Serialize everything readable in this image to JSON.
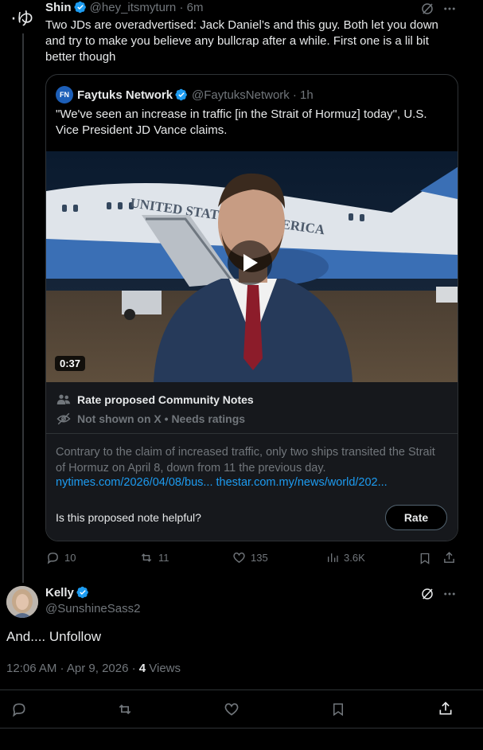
{
  "top_post": {
    "display_name": "Shin",
    "handle": "@hey_itsmyturn",
    "time": "· 6m",
    "text": "Two JDs are overadvertised: Jack Daniel’s and this guy. Both let you down and try to make you believe any bullcrap after a while. First one is a lil bit better though",
    "avatar_glyph": "·ゆ",
    "quoted": {
      "source_name": "Faytuks Network",
      "source_handle": "@FaytuksNetwork",
      "source_time": "· 1h",
      "logo_text": "FN",
      "text": "\"We've seen an increase in traffic [in the Strait of Hormuz] today\", U.S. Vice President JD Vance claims.",
      "video_duration": "0:37",
      "plane_text": "UNITED STATES OF AMERICA"
    },
    "community_notes": {
      "title": "Rate proposed Community Notes",
      "status": "Not shown on X • Needs ratings",
      "note_text": "Contrary to the claim of increased traffic, only two ships transited the Strait of Hormuz on April 8, down from 11 the previous day.",
      "link1": "nytimes.com/2026/04/08/bus...",
      "link2": "thestar.com.my/news/world/202...",
      "question": "Is this proposed note helpful?",
      "rate_label": "Rate"
    },
    "stats": {
      "replies": "10",
      "reposts": "11",
      "likes": "135",
      "views": "3.6K"
    }
  },
  "main_post": {
    "display_name": "Kelly",
    "handle": "@SunshineSass2",
    "text": "And.... Unfollow",
    "timestamp": "12:06 AM · Apr 9, 2026 · ",
    "views_count": "4",
    "views_label": " Views"
  },
  "colors": {
    "background": "#000000",
    "text": "#e7e9ea",
    "muted": "#71767b",
    "link": "#1d9bf0",
    "border": "#2f3336",
    "verified": "#1d9bf0"
  }
}
